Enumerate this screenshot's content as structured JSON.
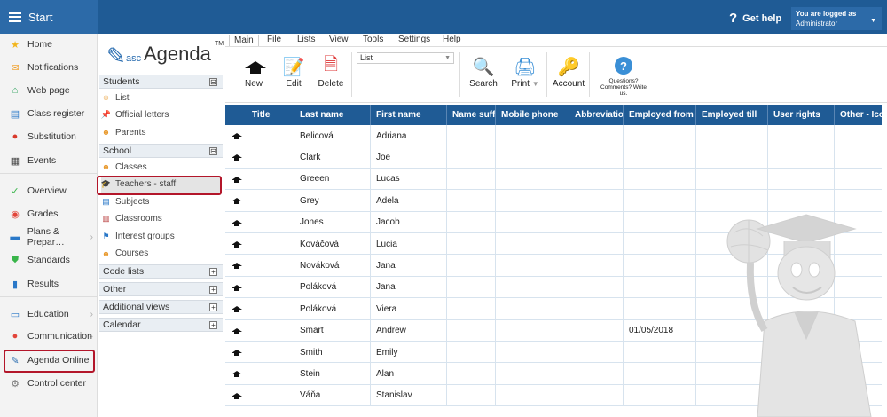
{
  "topbar": {
    "start_label": "Start",
    "help_label": "Get help",
    "logged_line": "You are logged as",
    "user": "Administrator"
  },
  "leftnav": [
    {
      "label": "Home",
      "icon": "star-icon",
      "color": "#f2b51c",
      "glyph": "★"
    },
    {
      "label": "Notifications",
      "icon": "envelope-icon",
      "color": "#f09a1e",
      "glyph": "✉"
    },
    {
      "label": "Web page",
      "icon": "house-icon",
      "color": "#2aa05a",
      "glyph": "⌂"
    },
    {
      "label": "Class register",
      "icon": "register-icon",
      "color": "#2a78c8",
      "glyph": "▤"
    },
    {
      "label": "Substitution",
      "icon": "substitution-icon",
      "color": "#d8392b",
      "glyph": "●"
    },
    {
      "label": "Events",
      "icon": "calendar-icon",
      "color": "#444444",
      "glyph": "▦"
    },
    {
      "label": "Overview",
      "icon": "check-circle-icon",
      "color": "#39b54a",
      "glyph": "✓"
    },
    {
      "label": "Grades",
      "icon": "grades-icon",
      "color": "#e2453a",
      "glyph": "◉"
    },
    {
      "label": "Plans & Prepar…",
      "icon": "briefcase-icon",
      "color": "#2a78c8",
      "glyph": "▬"
    },
    {
      "label": "Standards",
      "icon": "shield-icon",
      "color": "#39b54a",
      "glyph": "⛊"
    },
    {
      "label": "Results",
      "icon": "bar-chart-icon",
      "color": "#2a78c8",
      "glyph": "▮"
    },
    {
      "label": "Education",
      "icon": "education-icon",
      "color": "#2a78c8",
      "glyph": "▭"
    },
    {
      "label": "Communication",
      "icon": "chat-icon",
      "color": "#e2453a",
      "glyph": "●"
    },
    {
      "label": "Agenda Online",
      "icon": "feather-icon",
      "color": "#2a6db0",
      "glyph": "✎"
    },
    {
      "label": "Control center",
      "icon": "cog-icon",
      "color": "#777777",
      "glyph": "⚙"
    }
  ],
  "logo": {
    "asc": "asc",
    "name": "Agenda",
    "tm": "TM"
  },
  "panel": {
    "students": {
      "title": "Students",
      "items": [
        {
          "label": "List",
          "icon": "person-icon",
          "glyph": "☺",
          "color": "#e89a2f"
        },
        {
          "label": "Official letters",
          "icon": "pin-icon",
          "glyph": "📌",
          "color": "#d33"
        },
        {
          "label": "Parents",
          "icon": "parents-icon",
          "glyph": "☻",
          "color": "#e89a2f"
        }
      ]
    },
    "school": {
      "title": "School",
      "items": [
        {
          "label": "Classes",
          "icon": "classes-icon",
          "glyph": "☻",
          "color": "#e89a2f"
        },
        {
          "label": "Teachers - staff",
          "icon": "grad-cap-icon",
          "glyph": "🎓",
          "color": "#333"
        },
        {
          "label": "Subjects",
          "icon": "book-icon",
          "glyph": "▤",
          "color": "#2a78c8"
        },
        {
          "label": "Classrooms",
          "icon": "classroom-icon",
          "glyph": "▥",
          "color": "#b44"
        },
        {
          "label": "Interest groups",
          "icon": "group-icon",
          "glyph": "⚑",
          "color": "#2a78c8"
        },
        {
          "label": "Courses",
          "icon": "courses-icon",
          "glyph": "☻",
          "color": "#e89a2f"
        }
      ]
    },
    "code_lists": "Code lists",
    "other": "Other",
    "additional_views": "Additional views",
    "calendar": "Calendar",
    "collapse_sign": "⊟",
    "expand_sign": "+"
  },
  "menu": [
    "Main",
    "File",
    "Lists",
    "View",
    "Tools",
    "Settings",
    "Help"
  ],
  "toolbar": {
    "new": "New",
    "edit": "Edit",
    "delete": "Delete",
    "list_value": "List",
    "search": "Search",
    "print": "Print",
    "account": "Account",
    "questions": "Questions? Comments? Write us."
  },
  "grid": {
    "columns": [
      "Title",
      "Last name",
      "First name",
      "Name suffix",
      "Mobile phone",
      "Abbreviation",
      "Employed from",
      "Employed till",
      "User rights",
      "Other - Icons"
    ],
    "rows": [
      {
        "title": "",
        "last": "Belicová",
        "first": "Adriana",
        "employed_from": ""
      },
      {
        "title": "",
        "last": "Clark",
        "first": "Joe",
        "employed_from": ""
      },
      {
        "title": "",
        "last": "Greeen",
        "first": "Lucas",
        "employed_from": ""
      },
      {
        "title": "",
        "last": "Grey",
        "first": "Adela",
        "employed_from": ""
      },
      {
        "title": "",
        "last": "Jones",
        "first": "Jacob",
        "employed_from": ""
      },
      {
        "title": "",
        "last": "Kováčová",
        "first": "Lucia",
        "employed_from": ""
      },
      {
        "title": "",
        "last": "Nováková",
        "first": "Jana",
        "employed_from": ""
      },
      {
        "title": "",
        "last": "Poláková",
        "first": "Jana",
        "employed_from": ""
      },
      {
        "title": "",
        "last": "Poláková",
        "first": "Viera",
        "employed_from": ""
      },
      {
        "title": "",
        "last": "Smart",
        "first": "Andrew",
        "employed_from": "01/05/2018"
      },
      {
        "title": "",
        "last": "Smith",
        "first": "Emily",
        "employed_from": ""
      },
      {
        "title": "",
        "last": "Stein",
        "first": "Alan",
        "employed_from": ""
      },
      {
        "title": "",
        "last": "Váňa",
        "first": "Stanislav",
        "employed_from": ""
      }
    ]
  },
  "colors": {
    "header_blue": "#1f5b95",
    "highlight_red": "#b3162a"
  }
}
